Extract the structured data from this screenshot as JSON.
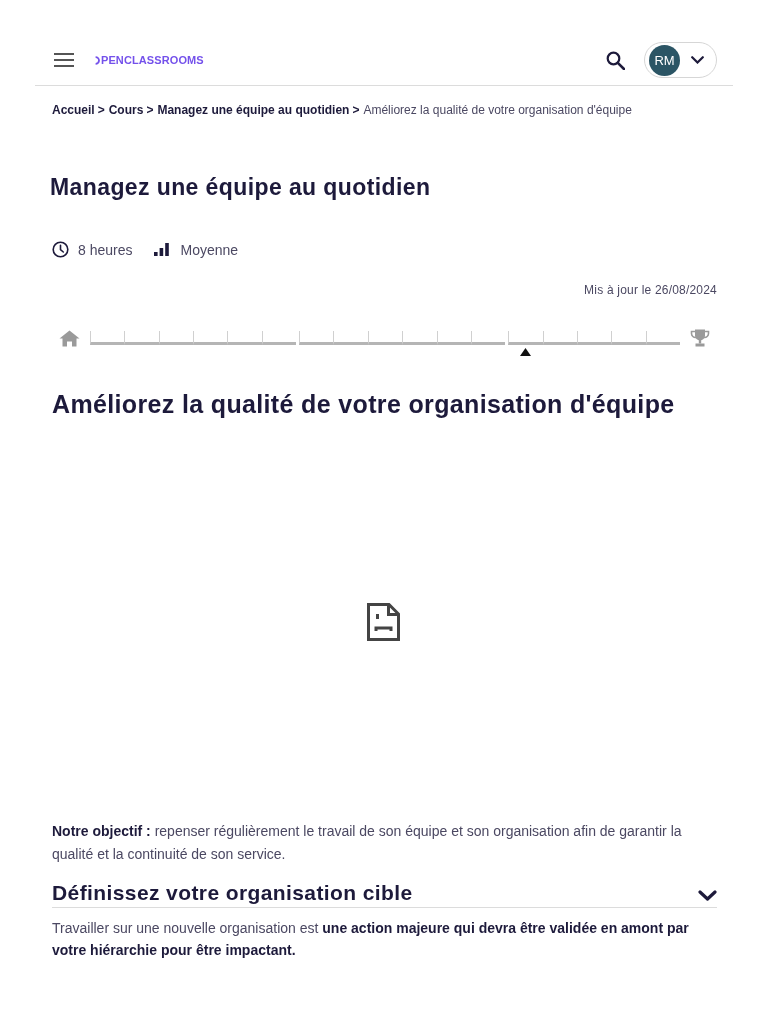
{
  "header": {
    "logo": "PENCLASSROOMS",
    "avatar_initials": "RM"
  },
  "breadcrumb": [
    {
      "label": "Accueil",
      "link": true,
      "separator": ">"
    },
    {
      "label": "Cours",
      "link": true,
      "separator": ">"
    },
    {
      "label": "Managez une équipe au quotidien",
      "link": true,
      "separator": ">"
    },
    {
      "label": "Améliorez la qualité de votre organisation d'équipe",
      "link": false
    }
  ],
  "course": {
    "title": "Managez une équipe au quotidien",
    "duration": "8 heures",
    "difficulty": "Moyenne",
    "updated": "Mis à jour le 26/08/2024"
  },
  "progress": {
    "parts": [
      {
        "chapters": [
          {
            "current": false
          },
          {
            "current": false
          },
          {
            "current": false
          },
          {
            "current": false
          },
          {
            "current": false
          },
          {
            "current": false
          }
        ]
      },
      {
        "chapters": [
          {
            "current": false
          },
          {
            "current": false
          },
          {
            "current": false
          },
          {
            "current": false
          },
          {
            "current": false
          },
          {
            "current": false
          }
        ]
      },
      {
        "chapters": [
          {
            "current": true
          },
          {
            "current": false
          },
          {
            "current": false
          },
          {
            "current": false
          },
          {
            "current": false
          }
        ]
      }
    ]
  },
  "chapter": {
    "title": "Améliorez la qualité de votre organisation d'équipe",
    "objective": "**Notre objectif :** repenser régulièrement le travail de son équipe et son organisation afin de garantir la qualité et la continuité de son service.",
    "sections": [
      {
        "title": "Définissez votre organisation cible",
        "text": "Travailler sur une nouvelle organisation est **une action majeure qui devra être validée en amont par votre hiérarchie pour être impactant.**"
      }
    ]
  }
}
